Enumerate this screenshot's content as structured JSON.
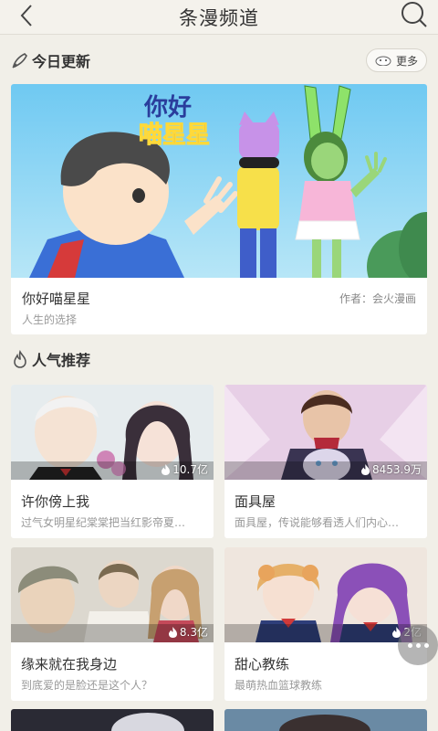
{
  "header": {
    "title": "条漫频道"
  },
  "today_update": {
    "title": "今日更新",
    "more_label": "更多",
    "featured": {
      "logo_line1": "你好",
      "logo_line2": "喵星星",
      "name": "你好喵星星",
      "description": "人生的选择",
      "author": "作者：会火漫画"
    }
  },
  "popular": {
    "title": "人气推荐",
    "items": [
      {
        "name": "许你傍上我",
        "description": "过气女明星纪棠棠把当红影帝夏…",
        "heat": "10.7亿"
      },
      {
        "name": "面具屋",
        "description": "面具屋，传说能够看透人们内心…",
        "heat": "8453.9万"
      },
      {
        "name": "缘来就在我身边",
        "description": "到底爱的是脸还是这个人？",
        "heat": "8.3亿"
      },
      {
        "name": "甜心教练",
        "description": "最萌热血篮球教练",
        "heat": "2亿"
      }
    ]
  },
  "colors": {
    "background": "#f1efe8",
    "card": "#ffffff",
    "text_primary": "#333333",
    "text_secondary": "#999999"
  }
}
